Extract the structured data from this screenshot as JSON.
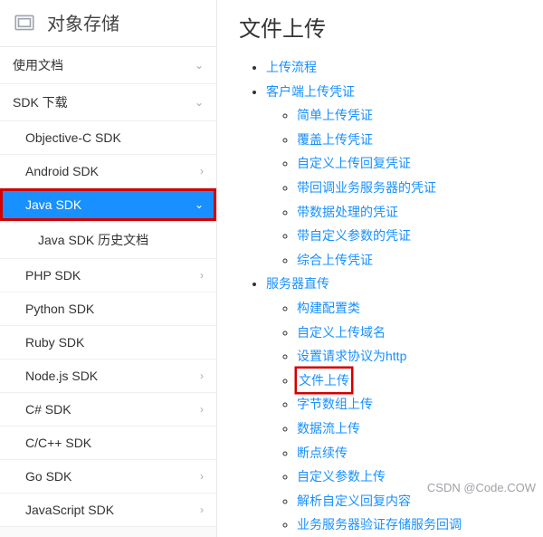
{
  "sidebar": {
    "title": "对象存储",
    "items": [
      {
        "label": "使用文档",
        "indent": 0,
        "expand": "chev-down",
        "selected": false
      },
      {
        "label": "SDK 下载",
        "indent": 0,
        "expand": "chev-down",
        "selected": false
      },
      {
        "label": "Objective-C SDK",
        "indent": 1,
        "expand": "",
        "selected": false
      },
      {
        "label": "Android SDK",
        "indent": 1,
        "expand": "chev-right",
        "selected": false
      },
      {
        "label": "Java SDK",
        "indent": 1,
        "expand": "chev-down",
        "selected": true
      },
      {
        "label": "Java SDK 历史文档",
        "indent": 2,
        "expand": "",
        "selected": false
      },
      {
        "label": "PHP SDK",
        "indent": 1,
        "expand": "chev-right",
        "selected": false
      },
      {
        "label": "Python SDK",
        "indent": 1,
        "expand": "",
        "selected": false
      },
      {
        "label": "Ruby SDK",
        "indent": 1,
        "expand": "",
        "selected": false
      },
      {
        "label": "Node.js SDK",
        "indent": 1,
        "expand": "chev-right",
        "selected": false
      },
      {
        "label": "C# SDK",
        "indent": 1,
        "expand": "chev-right",
        "selected": false
      },
      {
        "label": "C/C++ SDK",
        "indent": 1,
        "expand": "",
        "selected": false
      },
      {
        "label": "Go SDK",
        "indent": 1,
        "expand": "chev-right",
        "selected": false
      },
      {
        "label": "JavaScript SDK",
        "indent": 1,
        "expand": "chev-right",
        "selected": false
      }
    ]
  },
  "content": {
    "heading": "文件上传",
    "toc": [
      {
        "label": "上传流程"
      },
      {
        "label": "客户端上传凭证",
        "children": [
          {
            "label": "简单上传凭证"
          },
          {
            "label": "覆盖上传凭证"
          },
          {
            "label": "自定义上传回复凭证"
          },
          {
            "label": "带回调业务服务器的凭证"
          },
          {
            "label": "带数据处理的凭证"
          },
          {
            "label": "带自定义参数的凭证"
          },
          {
            "label": "综合上传凭证"
          }
        ]
      },
      {
        "label": "服务器直传",
        "children": [
          {
            "label": "构建配置类"
          },
          {
            "label": "自定义上传域名"
          },
          {
            "label": "设置请求协议为http"
          },
          {
            "label": "文件上传",
            "highlight": true
          },
          {
            "label": "字节数组上传"
          },
          {
            "label": "数据流上传"
          },
          {
            "label": "断点续传"
          },
          {
            "label": "自定义参数上传"
          },
          {
            "label": "解析自定义回复内容"
          },
          {
            "label": "业务服务器验证存储服务回调"
          }
        ]
      }
    ]
  },
  "watermark": "CSDN @Code.COW"
}
